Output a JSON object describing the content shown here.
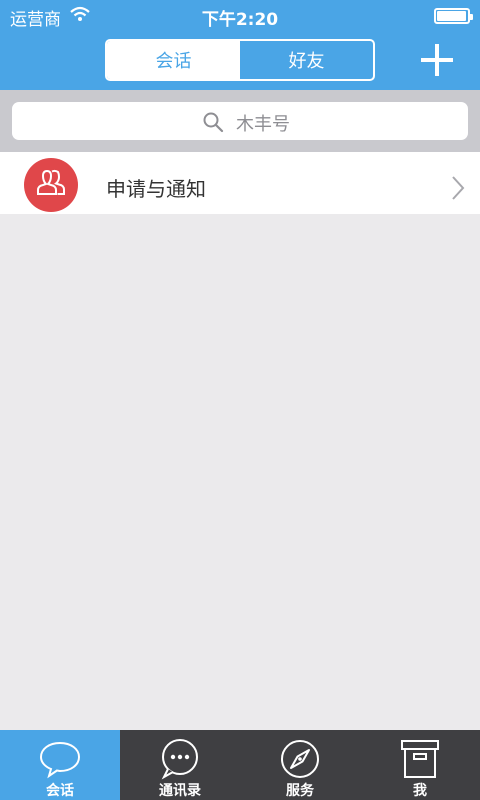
{
  "status_bar": {
    "carrier": "运营商",
    "time": "下午2:20"
  },
  "header": {
    "segments": [
      "会话",
      "好友"
    ]
  },
  "search": {
    "placeholder": "木丰号"
  },
  "list": {
    "items": [
      {
        "label": "申请与通知"
      }
    ]
  },
  "tabbar": {
    "tabs": [
      "会话",
      "通讯录",
      "服务",
      "我"
    ]
  },
  "colors": {
    "accent": "#4aa5e6",
    "avatar": "#e0474a",
    "tabbar": "#3f3f42"
  }
}
